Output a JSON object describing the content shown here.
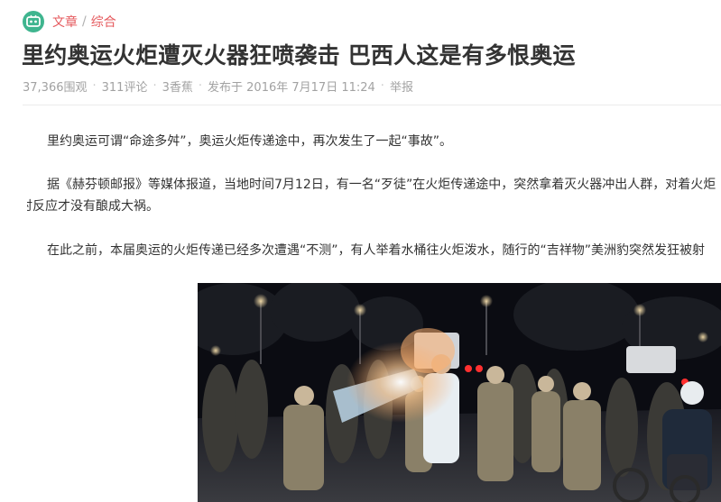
{
  "breadcrumb": {
    "category": "文章",
    "separator": "/",
    "subcategory": "综合"
  },
  "article": {
    "title": "里约奥运火炬遭灭火器狂喷袭击 巴西人这是有多恨奥运",
    "meta": {
      "views": "37,366围观",
      "comments": "311评论",
      "bananas": "3香蕉",
      "published": "发布于 2016年 7月17日 11:24",
      "report": "举报",
      "separator": "·"
    },
    "paragraphs": [
      "里约奥运可谓“命途多舛”，奥运火炬传递途中，再次发生了一起“事故”。",
      "据《赫芬顿邮报》等媒体报道，当地时间7月12日，有一名“歹徒”在火炬传递途中，突然拿着灭火器冲出人群，对着火炬",
      "及时反应才没有酿成大祸。",
      "在此之前，本届奥运的火炬传递已经多次遭遇“不测”，有人举着水桶往火炬泼水，随行的“吉祥物”美洲豹突然发狂被射"
    ]
  },
  "colors": {
    "accent": "#e5595d",
    "logo": "#3fb58f",
    "title": "#333333",
    "meta": "#a2a2a2"
  },
  "icons": {
    "logo": "acfun-tv-logo-icon"
  }
}
